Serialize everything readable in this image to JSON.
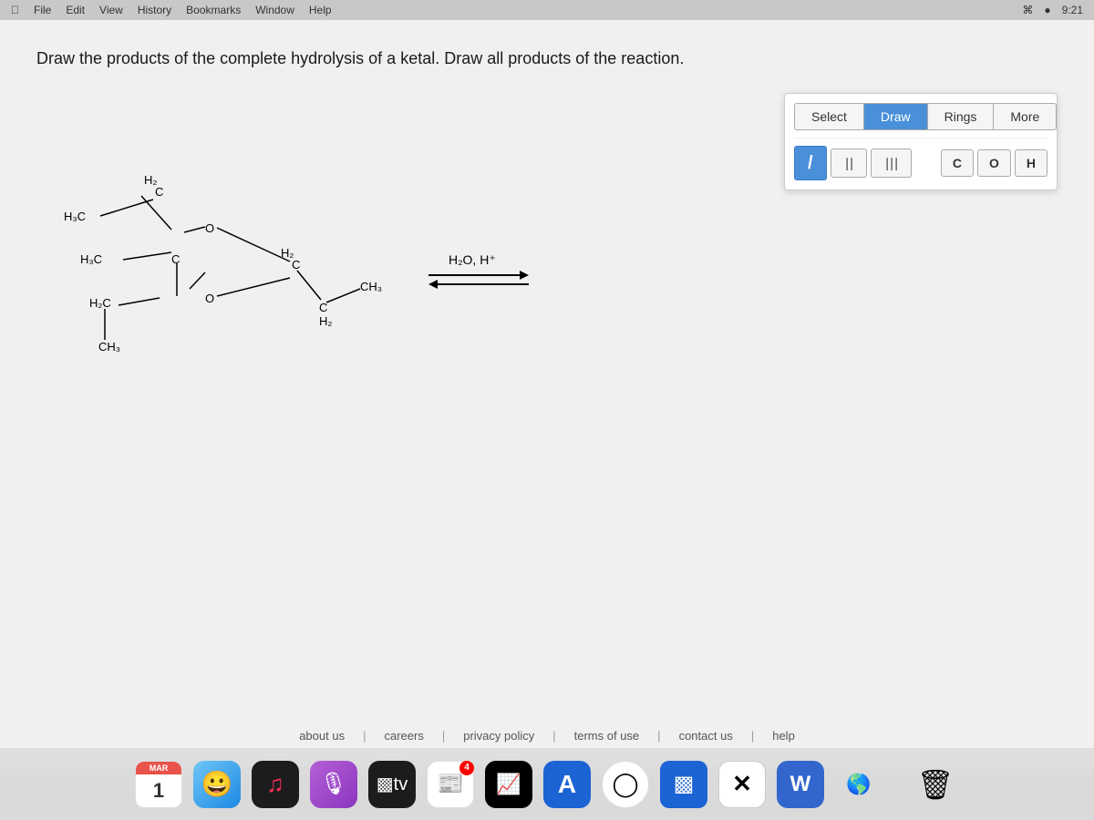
{
  "topbar": {
    "left": [
      "",
      "File",
      "Edit",
      "View",
      "History",
      "Bookmarks",
      "Window",
      "Help"
    ],
    "right": [
      "Wi-Fi",
      "Battery",
      "Time"
    ]
  },
  "page": {
    "question": "Draw the products of the complete hydrolysis of a ketal. Draw all products of the reaction."
  },
  "toolbar": {
    "select_label": "Select",
    "draw_label": "Draw",
    "rings_label": "Rings",
    "more_label": "More",
    "bond_single": "/",
    "bond_double": "||",
    "bond_triple": "|||",
    "atom_c": "C",
    "atom_o": "O",
    "atom_h": "H"
  },
  "reaction": {
    "reagents": "H₂O, H⁺",
    "arrow": "→"
  },
  "footer": {
    "links": [
      "about us",
      "careers",
      "privacy policy",
      "terms of use",
      "contact us",
      "help"
    ]
  },
  "dock": {
    "calendar_month": "MAR",
    "calendar_day": "1",
    "badge_count": "4"
  }
}
